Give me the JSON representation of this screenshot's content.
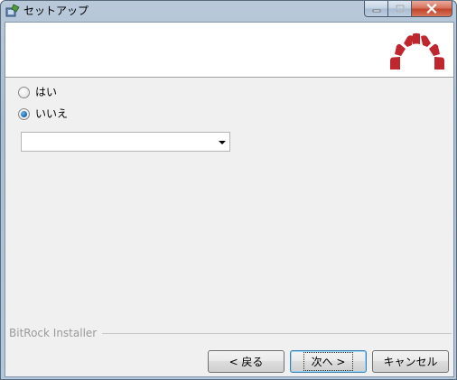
{
  "window": {
    "title": "セットアップ",
    "icon": "installer-icon",
    "caption_buttons": [
      "minimize-icon",
      "maximize-icon",
      "close-icon"
    ]
  },
  "header": {
    "logo": "redmine-logo"
  },
  "options": {
    "yes_label": "はい",
    "no_label": "いいえ",
    "selected": "いいえ"
  },
  "dropdown": {
    "value": ""
  },
  "brand": {
    "text": "BitRock Installer"
  },
  "buttons": {
    "back": "< 戻る",
    "next": "次へ >",
    "cancel": "キャンセル"
  },
  "colors": {
    "logo_red": "#c0262d",
    "radio_selected": "#1f6fb3"
  }
}
